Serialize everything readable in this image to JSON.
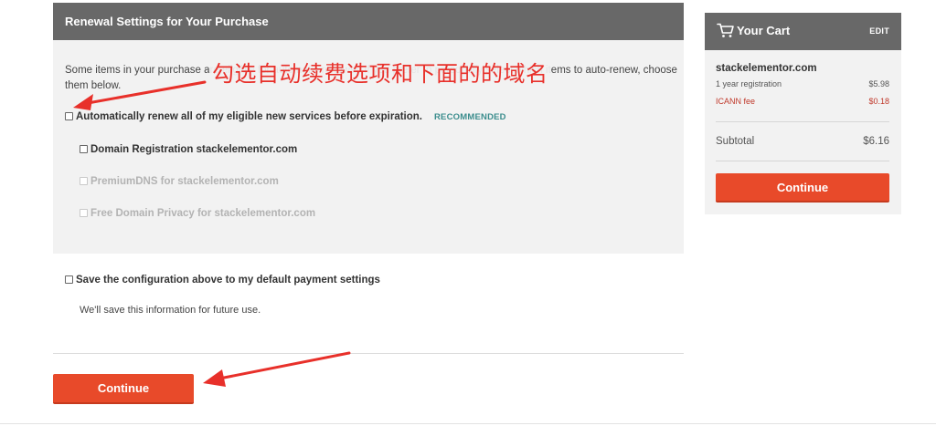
{
  "panel": {
    "title": "Renewal Settings for Your Purchase",
    "intro": "Some items in your purchase are eligible for automatic renewal. If you prefer to personally select which items to auto-renew, choose them below."
  },
  "options": {
    "auto_renew_all": "Automatically renew all of my eligible new services before expiration.",
    "recommended_badge": "RECOMMENDED",
    "items": [
      {
        "label": "Domain Registration stackelementor.com",
        "enabled": true
      },
      {
        "label": "PremiumDNS for stackelementor.com",
        "enabled": false
      },
      {
        "label": "Free Domain Privacy for stackelementor.com",
        "enabled": false
      }
    ]
  },
  "save_config": {
    "label": "Save the configuration above to my default payment settings",
    "note": "We'll save this information for future use."
  },
  "continue_label": "Continue",
  "cart": {
    "title": "Your Cart",
    "edit_label": "EDIT",
    "domain": "stackelementor.com",
    "lines": [
      {
        "label": "1 year registration",
        "amount": "$5.98"
      },
      {
        "label": "ICANN fee",
        "amount": "$0.18"
      }
    ],
    "subtotal_label": "Subtotal",
    "subtotal_amount": "$6.16",
    "continue_label": "Continue"
  },
  "annotation": {
    "text": "勾选自动续费选项和下面的的域名",
    "color": "#e8302a"
  },
  "colors": {
    "header_bg": "#686868",
    "panel_bg": "#f2f2f2",
    "accent": "#e84a2a",
    "recommended": "#3b8d8d",
    "fee": "#c0392b"
  }
}
